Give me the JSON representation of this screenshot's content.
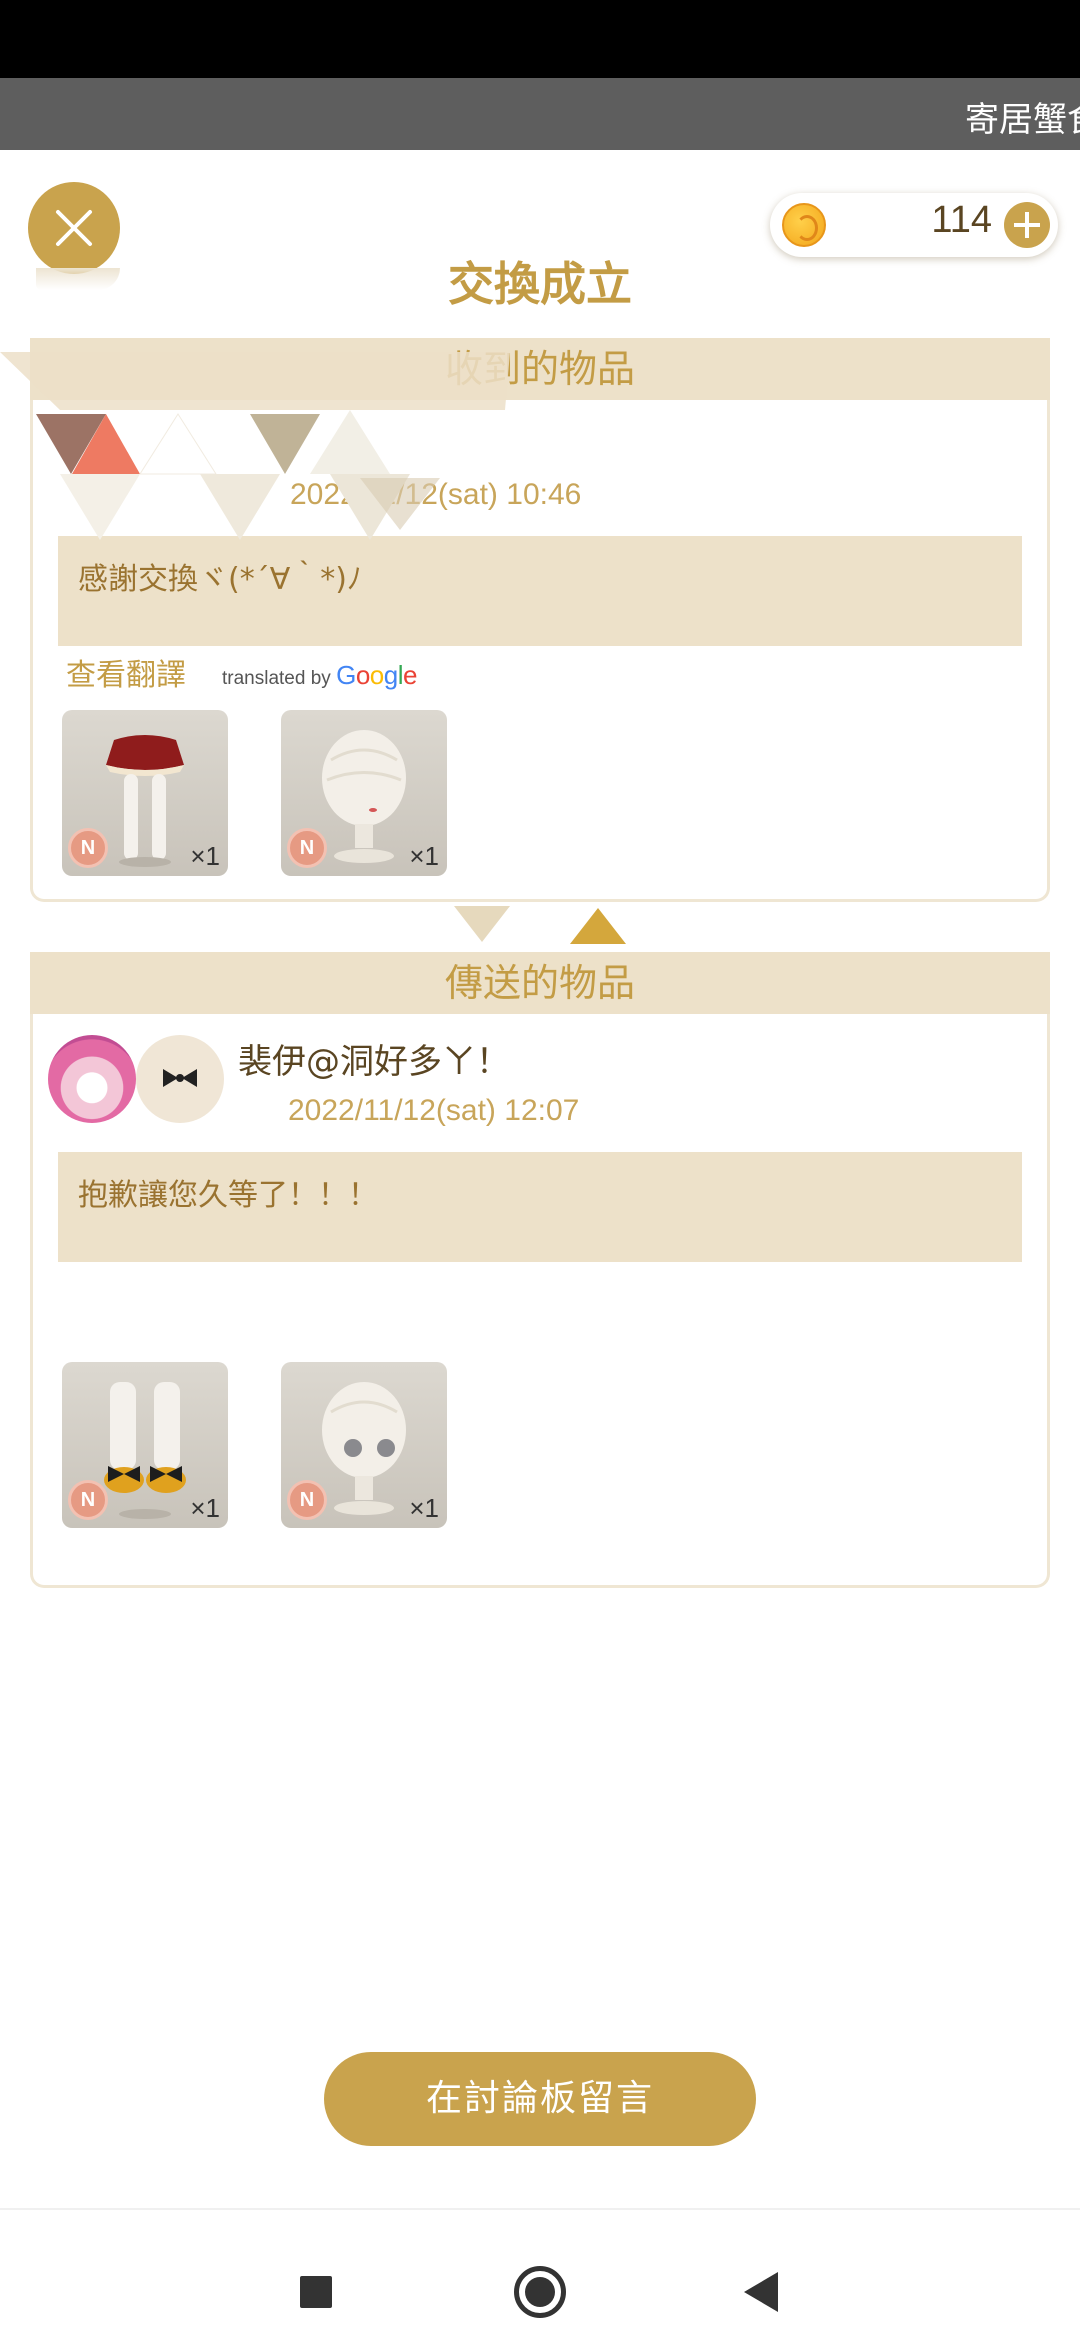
{
  "ticker": {
    "text": "寄居蟹食"
  },
  "header": {
    "coin_value": "114",
    "title": "交換成立"
  },
  "received": {
    "section_title": "收到的物品",
    "time": "2022/11/12(sat) 10:46",
    "message": "感謝交換ヾ(*´∀｀*)ﾉ",
    "translate_label": "查看翻譯",
    "translated_by": "translated by",
    "google": "Google",
    "items": [
      {
        "rarity": "N",
        "qty": "×1",
        "icon": "red-skirt-tights-icon"
      },
      {
        "rarity": "N",
        "qty": "×1",
        "icon": "mannequin-head-icon"
      }
    ]
  },
  "sent": {
    "section_title": "傳送的物品",
    "sender_name": "裴伊@洞好多ㄚ！",
    "time": "2022/11/12(sat) 12:07",
    "message": "抱歉讓您久等了！！！",
    "items": [
      {
        "rarity": "N",
        "qty": "×1",
        "icon": "socks-shoes-icon"
      },
      {
        "rarity": "N",
        "qty": "×1",
        "icon": "mannequin-eyes-icon"
      }
    ]
  },
  "forum_button": "在討論板留言",
  "colors": {
    "accent": "#c9a34d",
    "title_gold": "#c39c45",
    "panel_beige": "#ede1c9"
  }
}
